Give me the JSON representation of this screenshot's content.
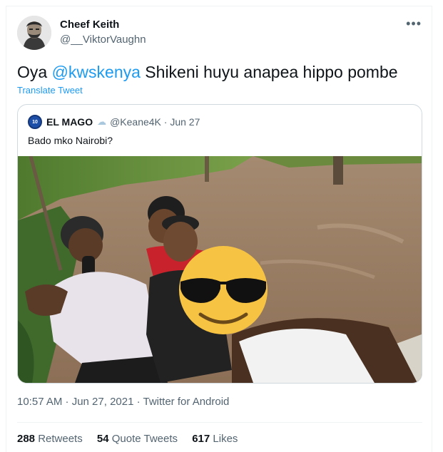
{
  "author": {
    "display_name": "Cheef Keith",
    "handle": "@__ViktorVaughn",
    "avatar_icon": "profile-photo"
  },
  "more_icon": "more-horizontal-icon",
  "tweet": {
    "prefix": "Oya ",
    "mention": "@kwskenya",
    "suffix": " Shikeni huyu anapea hippo pombe",
    "translate_label": "Translate Tweet"
  },
  "quote": {
    "avatar_text": "10",
    "name": "EL MAGO",
    "badge_icon": "cloud-icon",
    "handle_date": "@Keane4K · Jun 27",
    "text": "Bado mko Nairobi?"
  },
  "meta": {
    "timestamp": "10:57 AM · Jun 27, 2021 · Twitter for Android"
  },
  "stats": {
    "retweets_count": "288",
    "retweets_label": " Retweets",
    "quotes_count": "54",
    "quotes_label": " Quote Tweets",
    "likes_count": "617",
    "likes_label": " Likes"
  },
  "colors": {
    "accent": "#1d9bf0",
    "text": "#0f1419",
    "secondary": "#536471"
  }
}
